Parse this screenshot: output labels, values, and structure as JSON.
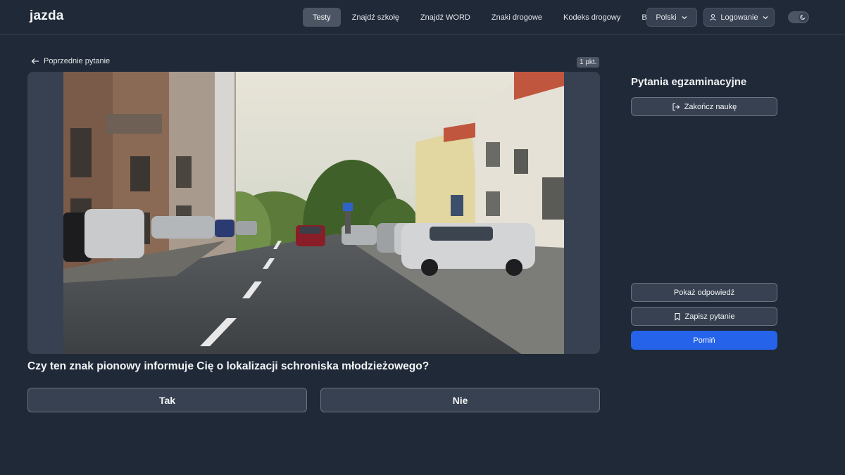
{
  "header": {
    "logo": "jazda",
    "nav": [
      "Testy",
      "Znajdź szkołę",
      "Znajdź WORD",
      "Znaki drogowe",
      "Kodeks drogowy",
      "Blog"
    ],
    "active_nav": "Testy",
    "language": "Polski",
    "login": "Logowanie"
  },
  "question": {
    "prev_label": "Poprzednie pytanie",
    "points": "1 pkt.",
    "text": "Czy ten znak pionowy informuje Cię o lokalizacji schroniska młodzieżowego?",
    "answers": [
      "Tak",
      "Nie"
    ]
  },
  "sidebar": {
    "title": "Pytania egzaminacyjne",
    "finish_label": "Zakończ naukę",
    "show_answer_label": "Pokaż odpowiedź",
    "save_label": "Zapisz pytanie",
    "skip_label": "Pomiń"
  },
  "colors": {
    "background": "#1f2937",
    "card": "#374151",
    "accent": "#2563eb"
  }
}
